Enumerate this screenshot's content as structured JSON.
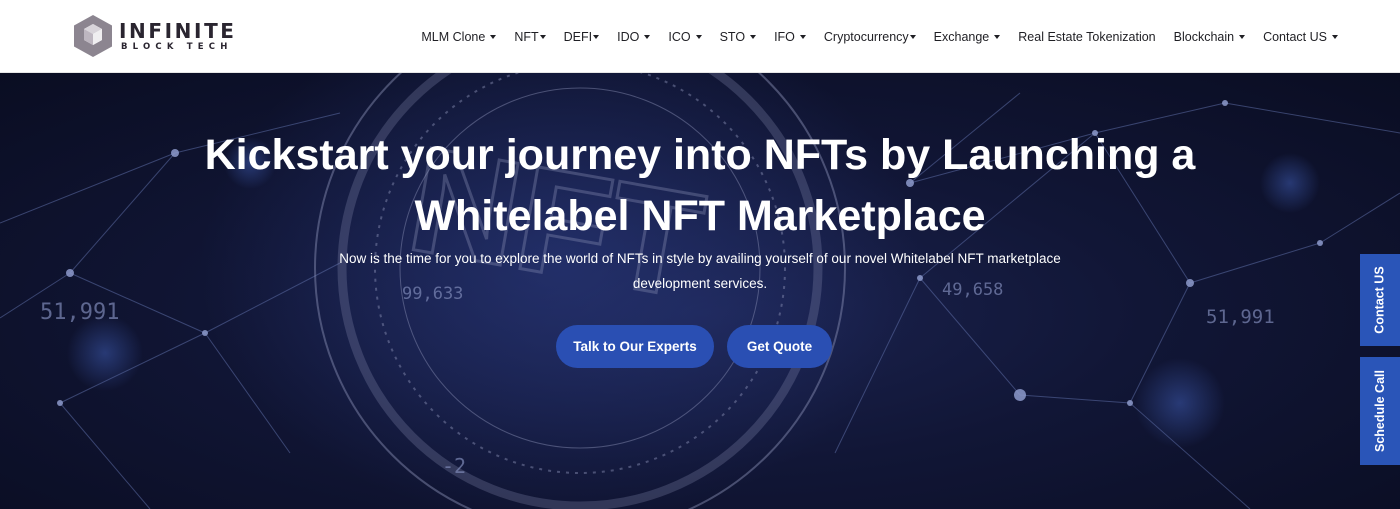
{
  "brand": {
    "name": "INFINITE",
    "tagline": "BLOCK TECH",
    "logo_icon": "cube-hexagon-icon"
  },
  "nav": {
    "items": [
      {
        "label": "MLM Clone",
        "dropdown": true
      },
      {
        "label": "NFT",
        "dropdown": true
      },
      {
        "label": "DEFI",
        "dropdown": true
      },
      {
        "label": "IDO",
        "dropdown": true
      },
      {
        "label": "ICO",
        "dropdown": true
      },
      {
        "label": "STO",
        "dropdown": true
      },
      {
        "label": "IFO",
        "dropdown": true
      },
      {
        "label": "Cryptocurrency",
        "dropdown": true
      },
      {
        "label": "Exchange",
        "dropdown": true
      },
      {
        "label": "Real Estate Tokenization",
        "dropdown": false
      },
      {
        "label": "Blockchain",
        "dropdown": true
      },
      {
        "label": "Contact US",
        "dropdown": true
      }
    ]
  },
  "hero": {
    "title_line1": "Kickstart your journey into NFTs by Launching a",
    "title_line2": "Whitelabel NFT Marketplace",
    "subtitle_line1": "Now is the time for you to explore the world of NFTs in style by availing yourself of our novel Whitelabel NFT marketplace",
    "subtitle_line2": "development services.",
    "primary_button": "Talk to Our Experts",
    "secondary_button": "Get Quote",
    "background_text": {
      "nft": "NFT",
      "n1": "51,991",
      "n2": "99,633",
      "n3": "49,658",
      "n4": "51,991",
      "n5": "-2"
    }
  },
  "side_tabs": {
    "contact": "Contact US",
    "schedule": "Schedule Call"
  },
  "colors": {
    "accent": "#2a4fb3",
    "side_tab": "#2a55b8",
    "hero_dark": "#0a0d22",
    "header_bg": "#ffffff"
  }
}
